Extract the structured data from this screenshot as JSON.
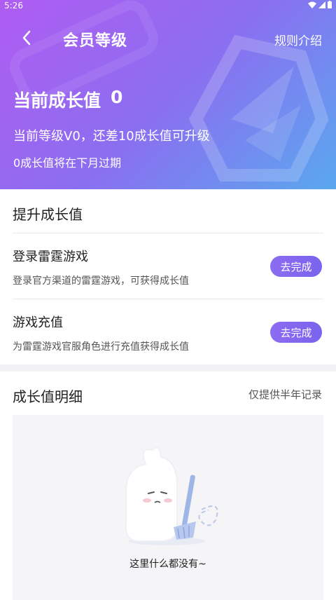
{
  "status_bar": {
    "time": "5:26",
    "icons": [
      "wifi-icon",
      "signal-icon",
      "battery-icon"
    ]
  },
  "nav": {
    "title": "会员等级",
    "rules_label": "规则介绍",
    "back_icon": "chevron-left-icon"
  },
  "hero": {
    "growth_label": "当前成长值",
    "growth_value": "0",
    "level_text": "当前等级V0，还差10成长值可升级",
    "expire_text": "0成长值将在下月过期"
  },
  "upgrade": {
    "title": "提升成长值",
    "tasks": [
      {
        "title": "登录雷霆游戏",
        "desc": "登录官方渠道的雷霆游戏，可获得成长值",
        "button": "去完成"
      },
      {
        "title": "游戏充值",
        "desc": "为雷霆游戏官服角色进行充值获得成长值",
        "button": "去完成"
      }
    ]
  },
  "details": {
    "title": "成长值明细",
    "note": "仅提供半年记录",
    "empty_text": "这里什么都没有~"
  },
  "colors": {
    "hero_start": "#b05cf2",
    "hero_end": "#5aa8ef",
    "button": "#8d6cf0"
  }
}
